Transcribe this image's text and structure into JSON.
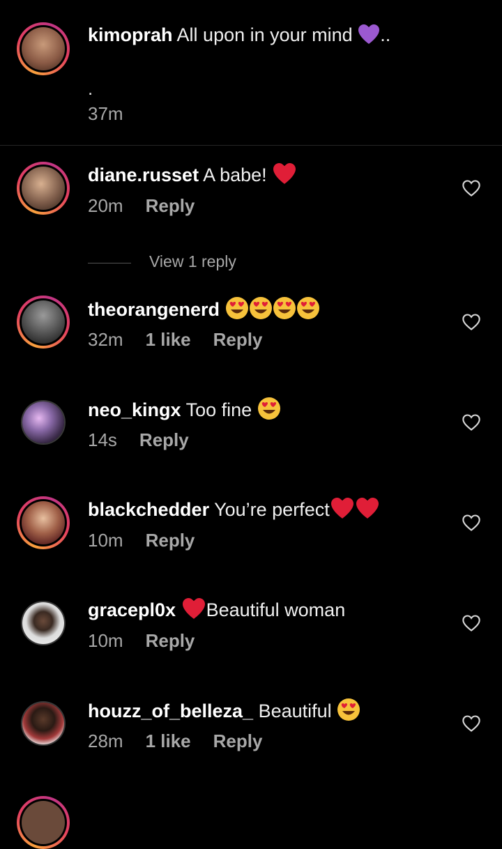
{
  "caption": {
    "username": "kimoprah",
    "text": "All upon in your mind",
    "suffix": "..",
    "dot": ".",
    "time": "37m",
    "avatar_color": "#8a5a45"
  },
  "view_replies": "View 1 reply",
  "comments": [
    {
      "username": "diane.russet",
      "text": "A babe!",
      "time": "20m",
      "likes": "",
      "reply": "Reply",
      "avatar_color": "#7b5a48"
    },
    {
      "username": "theorangenerd",
      "text": "",
      "time": "32m",
      "likes": "1 like",
      "reply": "Reply",
      "avatar_color": "#555555"
    },
    {
      "username": "neo_kingx",
      "text": "Too fine",
      "time": "14s",
      "likes": "",
      "reply": "Reply",
      "avatar_color": "#5e4a6e"
    },
    {
      "username": "blackchedder",
      "text": "You’re perfect",
      "time": "10m",
      "likes": "",
      "reply": "Reply",
      "avatar_color": "#7a4438"
    },
    {
      "username": "gracepl0x",
      "text": "Beautiful woman",
      "time": "10m",
      "likes": "",
      "reply": "Reply",
      "avatar_color": "#dcdcdc"
    },
    {
      "username": "houzz_of_belleza_",
      "text": "Beautiful",
      "time": "28m",
      "likes": "1 like",
      "reply": "Reply",
      "avatar_color": "#a33a3a"
    }
  ],
  "icons": {
    "purple_heart": "#9b59d0",
    "red_heart": "#e01e37",
    "heart_eyes_face": "#f7c23b",
    "like_button": "heart-outline-icon"
  }
}
